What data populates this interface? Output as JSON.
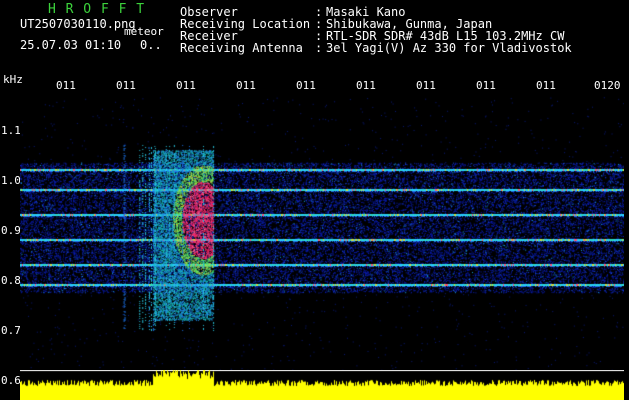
{
  "app": {
    "title": "H R O F F T",
    "file_name": "UT2507030110.png",
    "file_tag": "meteor",
    "date_time": "25.07.03 01:10",
    "extra": "0.."
  },
  "info": {
    "items": [
      {
        "label": "Observer",
        "colon": ":",
        "value": "Masaki Kano"
      },
      {
        "label": "Receiving Location",
        "colon": ":",
        "value": "Shibukawa, Gunma, Japan"
      },
      {
        "label": "Receiver",
        "colon": ":",
        "value": "RTL-SDR SDR# 43dB L15 103.2MHz CW"
      },
      {
        "label": "Receiving Antenna",
        "colon": ":",
        "value": "3el Yagi(V) Az 330 for Vladivostok"
      }
    ]
  },
  "axis": {
    "unit": "kHz",
    "y_ticks": [
      "1.1",
      "1.0",
      "0.9",
      "0.8",
      "0.7",
      "0.6"
    ],
    "x_ticks": [
      "011",
      "011",
      "011",
      "011",
      "011",
      "011",
      "011",
      "011",
      "011",
      "0120"
    ]
  },
  "spectrogram": {
    "freq_range": [
      0.6,
      1.1
    ],
    "carrier_lines_khz": [
      1.02,
      0.98,
      0.93,
      0.88,
      0.83,
      0.79
    ],
    "meteor_burst_time_fraction": [
      0.22,
      0.32
    ],
    "colors": {
      "background": "#000000",
      "noise": "#0a1cb4",
      "carrier": "#2ad0ff",
      "hot": "#ff2a6a",
      "mid": "#41e26a",
      "power": "#ffff00",
      "axis_text": "#ffffff",
      "title": "#3cd23c"
    }
  }
}
